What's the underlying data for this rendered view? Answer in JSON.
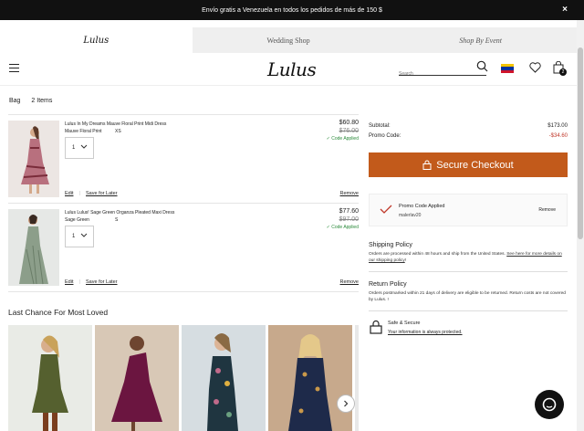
{
  "promo_bar": {
    "text": "Envío gratis a Venezuela en todos los pedidos de más de 150 $",
    "close": "×"
  },
  "site_tabs": [
    {
      "label": "Lulus",
      "active": true
    },
    {
      "label": "Wedding Shop",
      "active": false
    },
    {
      "label": "Shop By Event",
      "active": false
    }
  ],
  "header": {
    "logo": "Lulus",
    "search_placeholder": "Search",
    "bag_count": "2",
    "flag_colors": [
      "#f4c400",
      "#0033a0",
      "#cf142b"
    ]
  },
  "bag": {
    "label": "Bag",
    "count_label": "2 Items"
  },
  "items": [
    {
      "name": "Lulus In My Dreams Mauve Floral Print Midi Dress",
      "color": "Mauve Floral Print",
      "size": "XS",
      "qty": "1",
      "price": "$60.80",
      "old_price": "$76.00",
      "code_applied": "✓ Code Applied",
      "edit": "Edit",
      "save": "Save for Later",
      "remove": "Remove",
      "swatch": [
        "#c9a3a6",
        "#8a3d4c"
      ]
    },
    {
      "name": "Lulus Lulus! Sage Green Organza Pleated Maxi Dress",
      "color": "Sage Green",
      "size": "S",
      "qty": "1",
      "price": "$77.60",
      "old_price": "$97.00",
      "code_applied": "✓ Code Applied",
      "edit": "Edit",
      "save": "Save for Later",
      "remove": "Remove",
      "swatch": [
        "#b7c2b0",
        "#6c7f6a"
      ]
    }
  ],
  "summary": {
    "subtotal_label": "Subtotal:",
    "subtotal_value": "$173.00",
    "promo_label": "Promo Code:",
    "promo_value": "-$34.60",
    "checkout_label": "Secure Checkout",
    "promo_applied_title": "Promo Code Applied",
    "promo_code": "malerlav20",
    "promo_remove": "Remove"
  },
  "shipping_policy": {
    "title": "Shipping Policy",
    "text": "Orders are processed within 48 hours and ship from the United States.",
    "link": "See here for more details on our shipping policy",
    "suffix": "!"
  },
  "return_policy": {
    "title": "Return Policy",
    "text": "Orders postmarked within 21 days of delivery are eligible to be returned. Return costs are not covered by Lulus. !"
  },
  "safe_secure": {
    "title": "Safe & Secure",
    "link": "Your information is always protected."
  },
  "last_chance": {
    "title": "Last Chance For Most Loved",
    "products": [
      {
        "bg": "#e9ebe6",
        "dress": "#55602f"
      },
      {
        "bg": "#d8c8b6",
        "dress": "#6b1540"
      },
      {
        "bg": "#d6dde1",
        "dress": "#1f3540"
      },
      {
        "bg": "#c7a98c",
        "dress": "#1e2a4a"
      }
    ]
  }
}
